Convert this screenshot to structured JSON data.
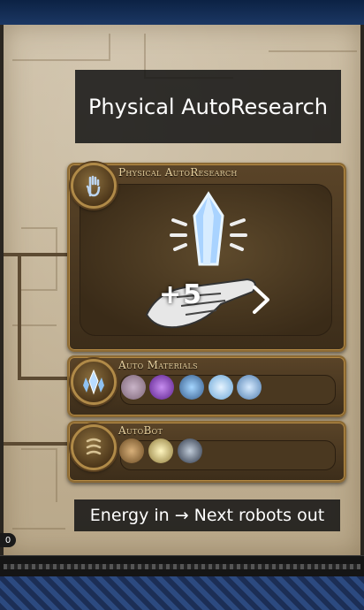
{
  "captions": {
    "top": "Physical AutoResearch",
    "bottom": "Energy in → Next robots out"
  },
  "panels": {
    "main": {
      "title": "Physical AutoResearch",
      "icon": "raised-hand-icon",
      "overlay_text": "+5"
    },
    "materials": {
      "title": "Auto Materials",
      "icon": "crystal-cluster-icon",
      "items": [
        "rock-ore-icon",
        "purple-gem-icon",
        "blue-shard-icon",
        "ice-crystal-icon",
        "crystal-cluster-icon"
      ]
    },
    "autobot": {
      "title": "AutoBot",
      "icon": "coil-rune-icon",
      "items": [
        "wrench-tool-icon",
        "gear-spark-icon",
        "robot-unit-icon"
      ]
    }
  },
  "status": {
    "counter": "0"
  },
  "colors": {
    "panel_border": "#8c6a33",
    "title_text": "#ead3a0",
    "caption_bg": "#141414",
    "parchment": "#c4b497"
  }
}
